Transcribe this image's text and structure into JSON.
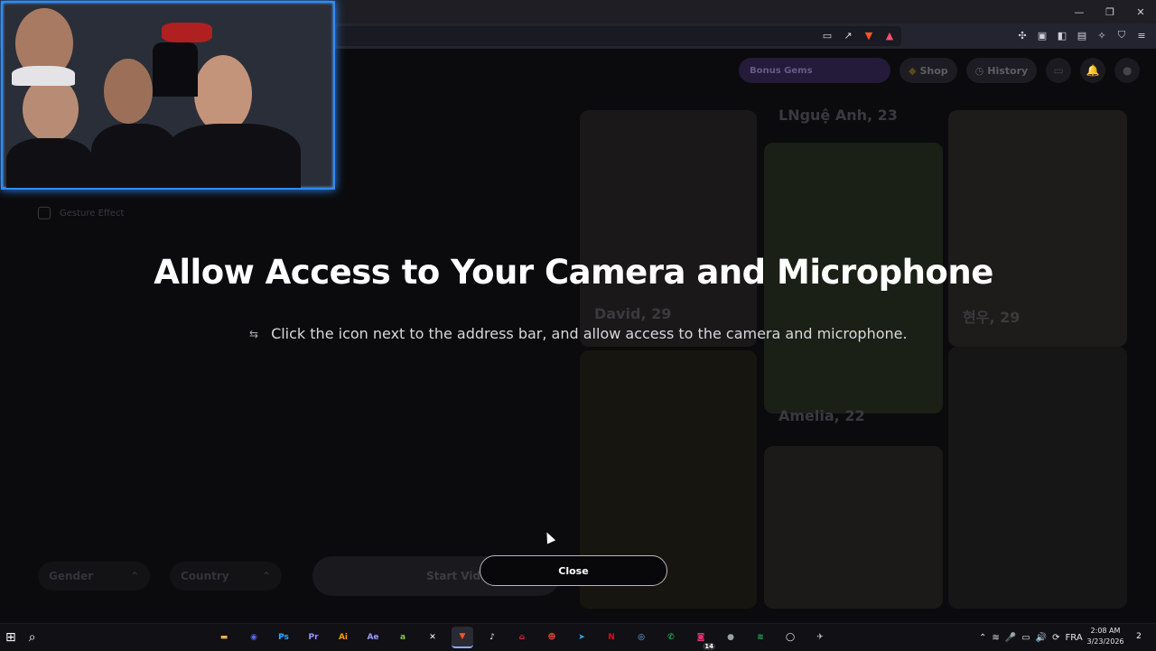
{
  "browser": {
    "window_controls": [
      "minimize",
      "restore",
      "close"
    ],
    "address_icons": [
      "cast-icon",
      "share-icon",
      "brave-shield-icon",
      "rewards-icon"
    ],
    "extension_icons": [
      "extensions-icon",
      "tab-icon",
      "sidebar-icon",
      "wallet-icon",
      "leo-icon",
      "vpn-icon",
      "menu-icon"
    ]
  },
  "page": {
    "promo_label": "Bonus Gems",
    "shop_label": "Shop",
    "history_label": "History",
    "gesture_label": "Gesture Effect",
    "cards": [
      {
        "label": "LNguệ Anh, 23"
      },
      {
        "label": "David, 29"
      },
      {
        "label": "현우, 29"
      },
      {
        "label": "Amelia, 22"
      }
    ],
    "gender_label": "Gender",
    "country_label": "Country",
    "start_label": "Start Video Chat"
  },
  "overlay": {
    "heading": "Allow Access to Your Camera and Microphone",
    "instruction": "Click the icon next to the address bar, and allow access to the camera and microphone.",
    "instruction_symbol": "⇆",
    "close_label": "Close"
  },
  "taskbar": {
    "apps": [
      {
        "name": "file-explorer",
        "glyph": "▬",
        "color": "#e8b24a"
      },
      {
        "name": "discord",
        "glyph": "◉",
        "color": "#5865f2"
      },
      {
        "name": "photoshop",
        "glyph": "Ps",
        "color": "#31a8ff"
      },
      {
        "name": "premiere",
        "glyph": "Pr",
        "color": "#9999ff"
      },
      {
        "name": "illustrator",
        "glyph": "Ai",
        "color": "#ff9a00"
      },
      {
        "name": "after-effects",
        "glyph": "Ae",
        "color": "#9999ff"
      },
      {
        "name": "app-green",
        "glyph": "a",
        "color": "#8bc34a"
      },
      {
        "name": "capcut",
        "glyph": "✕",
        "color": "#ffffff"
      },
      {
        "name": "brave",
        "glyph": "▼",
        "color": "#fb542b"
      },
      {
        "name": "tiktok",
        "glyph": "♪",
        "color": "#ffffff"
      },
      {
        "name": "app-red",
        "glyph": "⌂",
        "color": "#d02c3c"
      },
      {
        "name": "app-mask",
        "glyph": "☻",
        "color": "#c0392b"
      },
      {
        "name": "telegram",
        "glyph": "➤",
        "color": "#29a9ea"
      },
      {
        "name": "netflix",
        "glyph": "N",
        "color": "#e50914"
      },
      {
        "name": "steam",
        "glyph": "◎",
        "color": "#66c0f4"
      },
      {
        "name": "whatsapp",
        "glyph": "✆",
        "color": "#25d366"
      },
      {
        "name": "instagram",
        "glyph": "◙",
        "color": "#e1306c"
      },
      {
        "name": "chrome",
        "glyph": "●",
        "color": "#9aa0a6"
      },
      {
        "name": "spotify",
        "glyph": "≋",
        "color": "#1db954"
      },
      {
        "name": "app-ring",
        "glyph": "◯",
        "color": "#ffffff"
      },
      {
        "name": "app-bird",
        "glyph": "✈",
        "color": "#c8c8d0"
      }
    ],
    "instagram_badge": "14",
    "tray_language": "FRA",
    "time": "2:08 AM",
    "date": "3/23/2026",
    "notifications": "2"
  }
}
